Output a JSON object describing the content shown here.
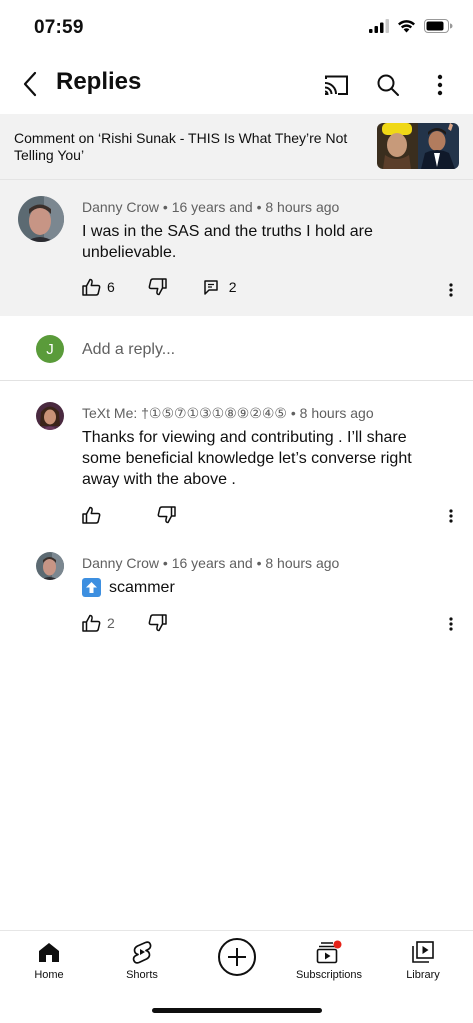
{
  "status_bar": {
    "time": "07:59"
  },
  "header": {
    "title": "Replies"
  },
  "context": {
    "text": "Comment on ‘Rishi Sunak - THIS Is What They’re Not Telling You’"
  },
  "parent_comment": {
    "author": "Danny Crow",
    "author_suffix": "16 years and",
    "time": "8 hours ago",
    "text": "I was in the SAS and the truths I hold are unbelievable.",
    "likes": "6",
    "replies": "2"
  },
  "reply_box": {
    "avatar_letter": "J",
    "placeholder": "Add a reply...",
    "value": ""
  },
  "replies": [
    {
      "author": "TeXt Me: †①⑤⑦①③①⑧⑨②④⑤",
      "time": "8 hours ago",
      "text": "Thanks for viewing and contributing . I’ll share some beneficial knowledge  let’s converse right away with the above .",
      "likes": ""
    },
    {
      "author": "Danny Crow",
      "author_suffix": "16 years and",
      "time": "8 hours ago",
      "emoji": "⬆️",
      "text": "scammer",
      "likes": "2"
    }
  ],
  "bottom_nav": {
    "home": "Home",
    "shorts": "Shorts",
    "subscriptions": "Subscriptions",
    "library": "Library"
  },
  "colors": {
    "background": "#ffffff",
    "context_bg": "#f2f2f2",
    "meta_text": "#606060",
    "reply_avatar": "#5a9b3a",
    "notification_dot": "#e62117"
  },
  "icons": {
    "status": [
      "signal-icon",
      "wifi-icon",
      "battery-icon"
    ],
    "header": [
      "back-icon",
      "cast-icon",
      "search-icon",
      "more-vert-icon"
    ],
    "comment_actions": [
      "like-icon",
      "dislike-icon",
      "reply-icon",
      "more-vert-icon"
    ],
    "nav": [
      "home-icon",
      "shorts-icon",
      "create-icon",
      "subscriptions-icon",
      "library-icon"
    ]
  }
}
